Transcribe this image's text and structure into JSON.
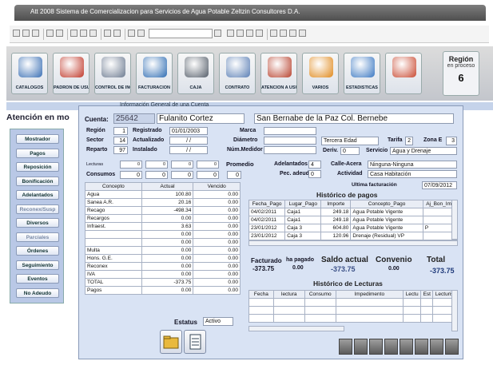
{
  "window": {
    "title": "Att 2008 Sistema de Comercializacion para Servicios de Agua Potable   Zeltzin Consultores D.A."
  },
  "modules": [
    {
      "label": "CATÁLOGOS",
      "color": "#3a6fb4"
    },
    {
      "label": "PADRÓN DE USUARIOS",
      "color": "#c0392b"
    },
    {
      "label": "CONTROL DE INGRESOS",
      "color": "#6d7b91"
    },
    {
      "label": "FACTURACIÓN",
      "color": "#2f6db3"
    },
    {
      "label": "CAJA",
      "color": "#555e6a"
    },
    {
      "label": "CONTRATO",
      "color": "#5b7fb5"
    },
    {
      "label": "ATENCIÓN A USUARIOS",
      "color": "#b8432f"
    },
    {
      "label": "VARIOS",
      "color": "#e08a1e"
    },
    {
      "label": "ESTADISTICAS",
      "color": "#3b78c2"
    },
    {
      "label": "",
      "color": "#c94a32"
    }
  ],
  "region": {
    "title": "Región",
    "subtitle": "en proceso",
    "value": "6"
  },
  "atencion_title": "Atención en mo",
  "sidebar": [
    {
      "label": "Mostrador",
      "dim": false
    },
    {
      "label": "Pagos",
      "dim": false
    },
    {
      "label": "Reposición",
      "dim": false
    },
    {
      "label": "Bonificación",
      "dim": false
    },
    {
      "label": "Adelantados",
      "dim": false
    },
    {
      "label": "Reconex/Susp",
      "dim": true
    },
    {
      "label": "Diversos",
      "dim": false
    },
    {
      "label": "Parciales",
      "dim": true
    },
    {
      "label": "Órdenes",
      "dim": false
    },
    {
      "label": "Seguimiento",
      "dim": false
    },
    {
      "label": "Eventos",
      "dim": false
    },
    {
      "label": "No Adeudo",
      "dim": false
    }
  ],
  "info": {
    "header": "Información General de una Cuenta",
    "cuenta_label": "Cuenta:",
    "cuenta_value": "25642",
    "nombre": "Fulanito Cortez",
    "direccion": "San Bernabe de la Paz  Col.  Bernebe",
    "region_label": "Región",
    "region_value": "1",
    "sector_label": "Sector",
    "sector_value": "14",
    "reparto_label": "Reparto",
    "reparto_value": "97",
    "registrado_label": "Registrado",
    "registrado_value": "01/01/2003",
    "actualizado_label": "Actualizado",
    "actualizado_value": "/ /",
    "instalado_label": "Instalado",
    "instalado_value": "/ /",
    "marca_label": "Marca",
    "diametro_label": "Diámetro",
    "medidor_label": "Núm.Medidor",
    "tarifa_grupo": "Tercera Edad",
    "tarifa_label": "Tarifa",
    "tarifa_value": "2",
    "zona_label": "Zona E",
    "zona_value": "3",
    "deriv_label": "Deriv.",
    "deriv_value": "0",
    "servicio_label": "Servicio",
    "servicio_value": "Agua y Drenaje",
    "lecturas_label": "Lecturas",
    "lecturas": [
      "0",
      "0",
      "0",
      "0"
    ],
    "promedio_label": "Promedio",
    "consumos_label": "Consumos",
    "consumos": [
      "0",
      "0",
      "0",
      "0"
    ],
    "consumos_promedio": "0",
    "adelantados_label": "Adelantados",
    "adelantados_value": "4",
    "pec_label": "Pec. adeudo",
    "pec_value": "0",
    "calle_label": "Calle-Acera",
    "calle_value": "Ninguna-Ninguna",
    "actividad_label": "Actividad",
    "actividad_value": "Casa Habitación",
    "ultima_label": "Ultima facturación",
    "ultima_value": "07/09/2012"
  },
  "ledger": {
    "headers": [
      "Concepto",
      "Actual",
      "Vencido"
    ],
    "rows": [
      [
        "Agua",
        "100.80",
        "0.00"
      ],
      [
        "Sanea A.R.",
        "20.16",
        "0.00"
      ],
      [
        "Recago",
        "-498.34",
        "0.00"
      ],
      [
        "Recargos",
        "0.00",
        "0.00"
      ],
      [
        "Infraest.",
        "3.63",
        "0.00"
      ],
      [
        "",
        "0.00",
        "0.00"
      ],
      [
        "",
        "0.00",
        "0.00"
      ],
      [
        "Multa",
        "0.00",
        "0.00"
      ],
      [
        "Hons. G.E.",
        "0.00",
        "0.00"
      ],
      [
        "Reconex",
        "0.00",
        "0.00"
      ],
      [
        "IVA",
        "0.00",
        "0.00"
      ],
      [
        "TOTAL",
        "-373.75",
        "0.00"
      ],
      [
        "Pagos",
        "0.00",
        "0.00"
      ]
    ]
  },
  "estatus": {
    "label": "Estatus",
    "value": "Activo"
  },
  "pagos": {
    "title": "Histórico de pagos",
    "headers": [
      "Fecha_Pago",
      "Lugar_Pago",
      "Importe",
      "Concepto_Pago",
      "Aj_Bon_Imp"
    ],
    "rows": [
      [
        "04/02/2011",
        "Caja1",
        "249.18",
        "Agua Potable Vigente",
        ""
      ],
      [
        "04/02/2011",
        "Caja1",
        "249.18",
        "Agua Potable Vigente",
        ""
      ],
      [
        "23/01/2012",
        "Caja 3",
        "604.80",
        "Agua Potable Vigente",
        "P"
      ],
      [
        "23/01/2012",
        "Caja 3",
        "120.96",
        "Drenaje (Residual) VP",
        ""
      ]
    ]
  },
  "summary": {
    "facturado_label": "Facturado",
    "facturado_value": "-373.75",
    "ha_pagado_label": "ha pagado",
    "ha_pagado_value": "0.00",
    "saldo_label": "Saldo actual",
    "saldo_value": "-373.75",
    "convenio_label": "Convenio",
    "convenio_value": "0.00",
    "total_label": "Total",
    "total_value": "-373.75"
  },
  "lecturas_hist": {
    "title": "Histórico de Lecturas",
    "headers": [
      "Fecha",
      "lectura",
      "Consumo",
      "Impedimento",
      "Lectu",
      "Est",
      "Lecturist"
    ]
  },
  "colors": {
    "panel": "#d9e3f4",
    "accent": "#1f3a7a"
  }
}
